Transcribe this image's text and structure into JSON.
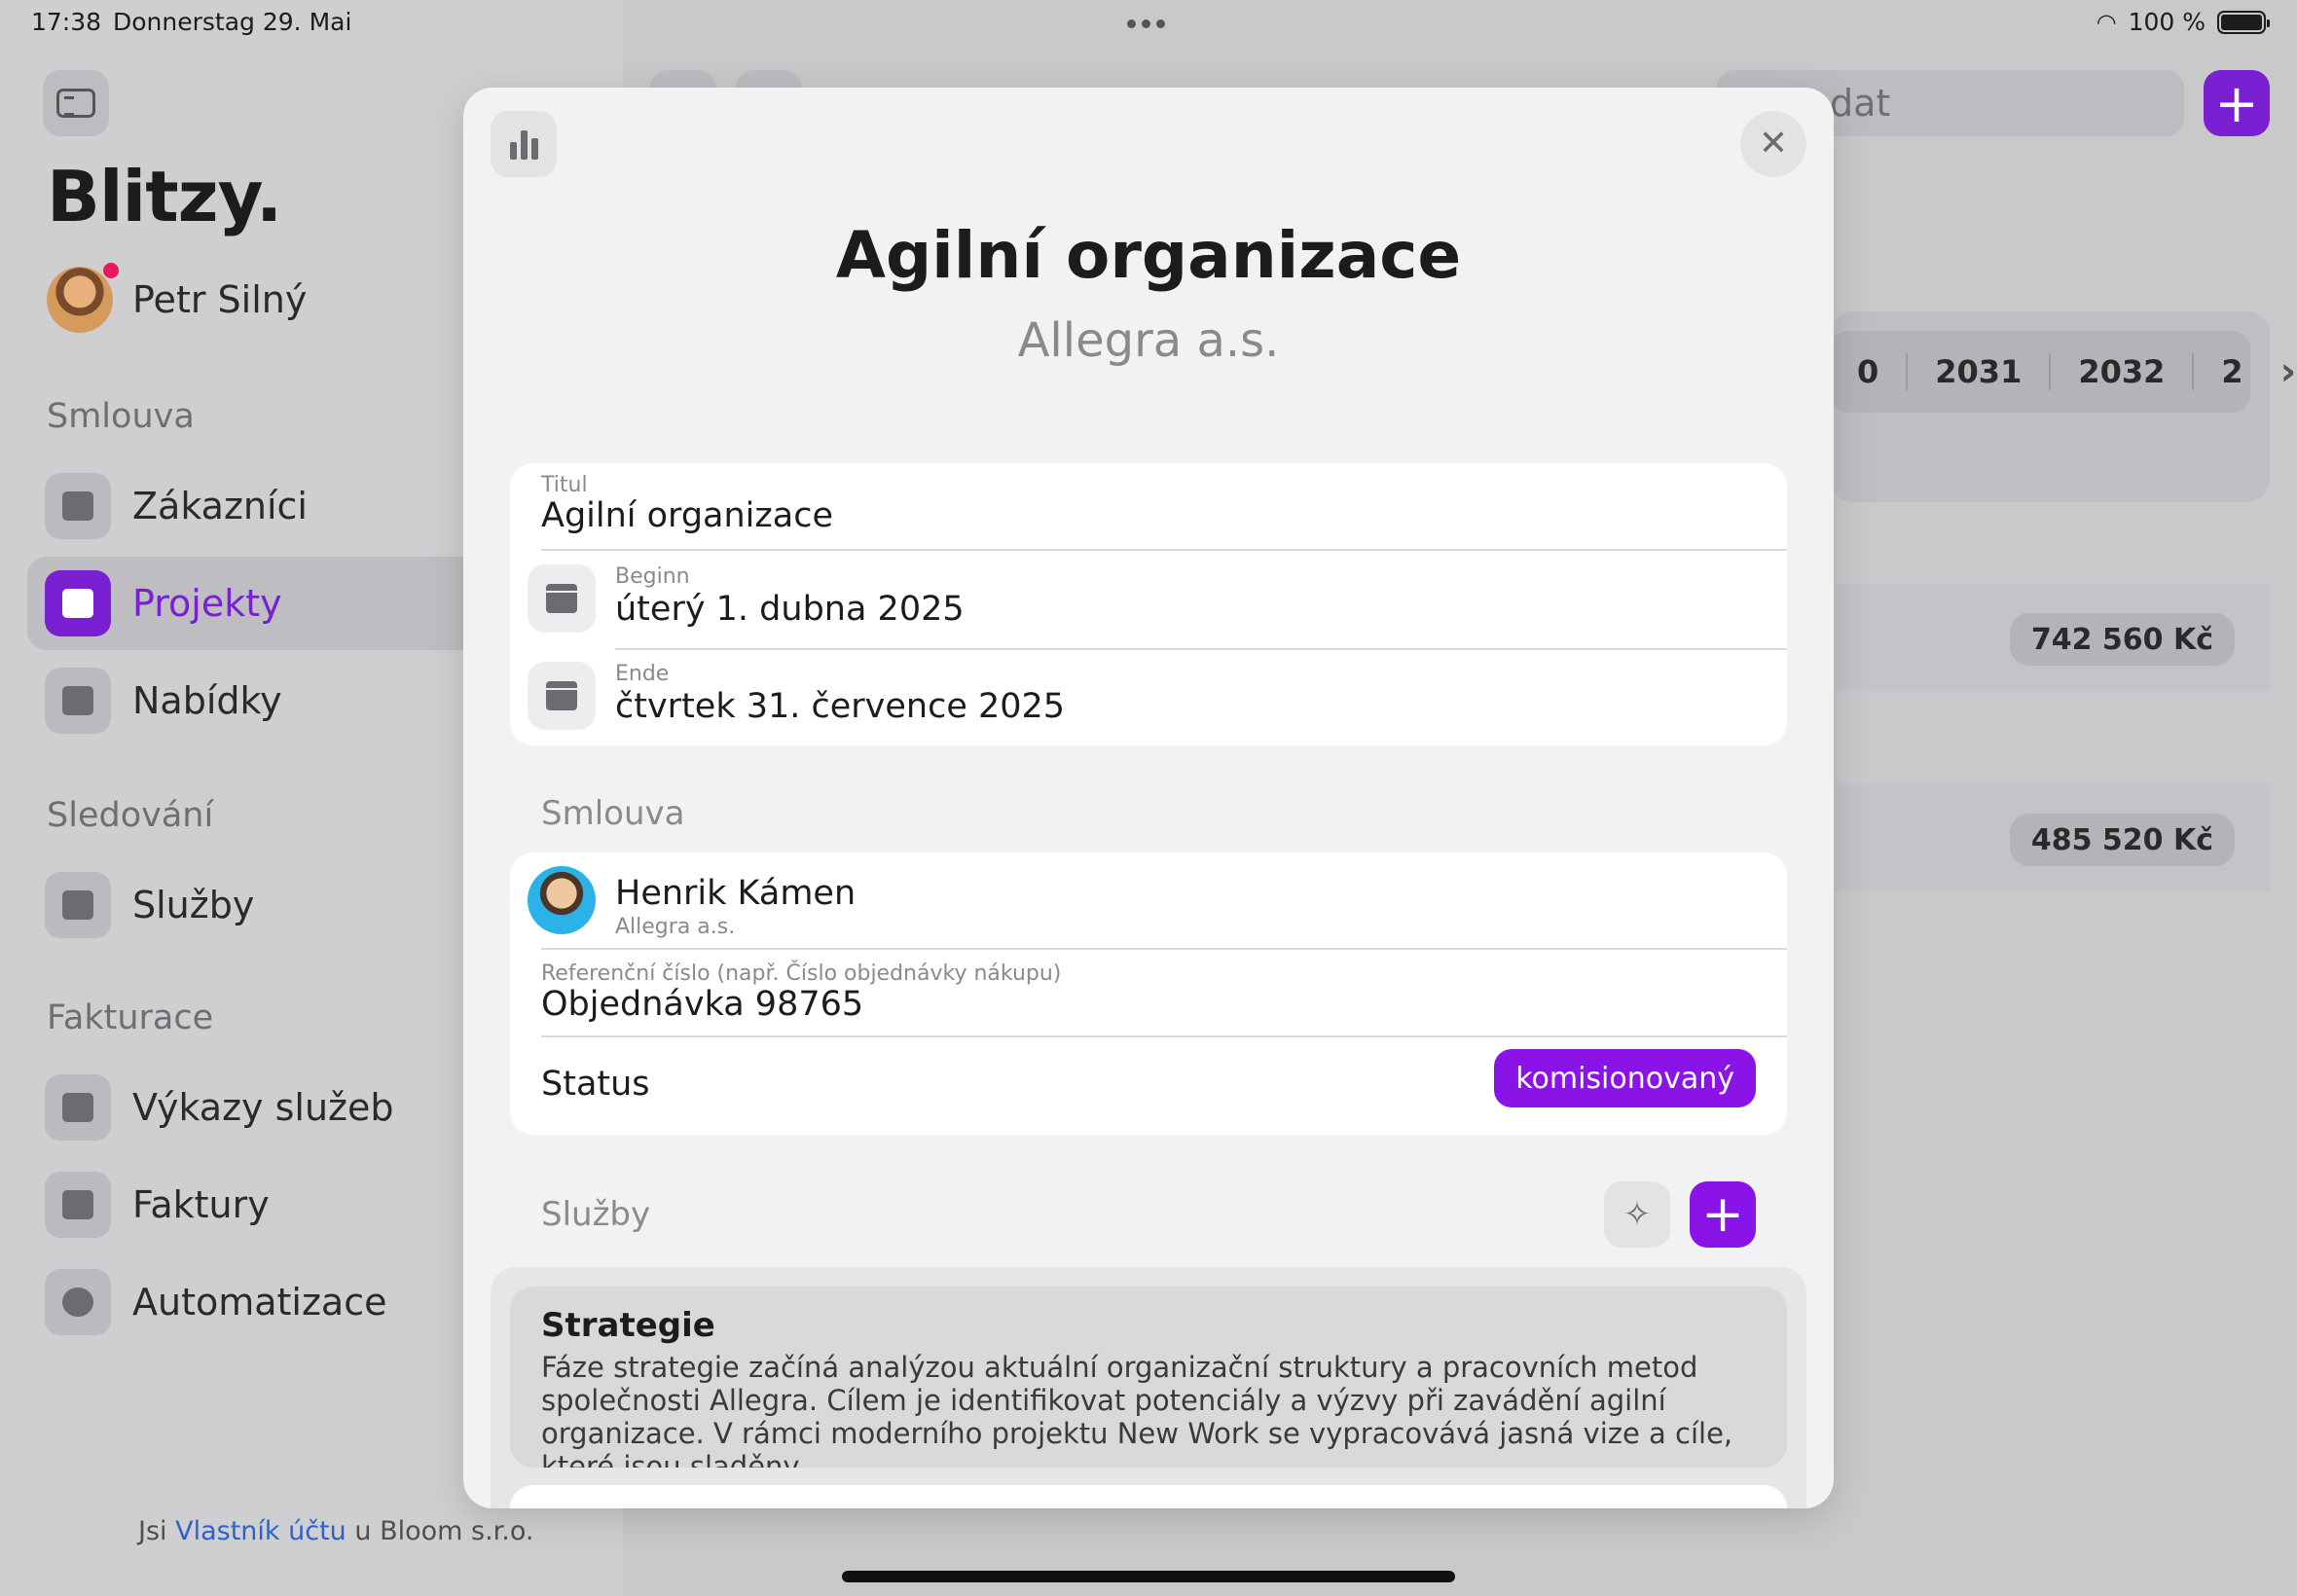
{
  "statusbar": {
    "time": "17:38",
    "date": "Donnerstag 29. Mai",
    "battery": "100 %"
  },
  "sidebar": {
    "brand": "Blitzy.",
    "user": {
      "name": "Petr Silný",
      "notification": true
    },
    "sections": [
      {
        "label": "Smlouva",
        "items": [
          {
            "label": "Zákazníci",
            "icon": "contact-card-icon",
            "active": false
          },
          {
            "label": "Projekty",
            "icon": "book-icon",
            "active": true
          },
          {
            "label": "Nabídky",
            "icon": "document-icon",
            "active": false
          }
        ]
      },
      {
        "label": "Sledování",
        "items": [
          {
            "label": "Služby",
            "icon": "calendar-icon",
            "active": false
          }
        ]
      },
      {
        "label": "Fakturace",
        "items": [
          {
            "label": "Výkazy služeb",
            "icon": "signature-icon",
            "active": false
          },
          {
            "label": "Faktury",
            "icon": "receipt-icon",
            "active": false
          },
          {
            "label": "Automatizace",
            "icon": "timer-icon",
            "active": false
          }
        ]
      }
    ],
    "footer": {
      "prefix": "Jsi ",
      "link": "Vlastník účtu",
      "suffix": " u Bloom s.r.o."
    }
  },
  "background": {
    "search_placeholder": "dat",
    "years": [
      "0",
      "2031",
      "2032",
      "2"
    ],
    "amounts": [
      "742 560 Kč",
      "485 520 Kč"
    ]
  },
  "modal": {
    "title": "Agilní organizace",
    "subtitle": "Allegra a.s.",
    "fields": {
      "titul": {
        "label": "Titul",
        "value": "Agilní organizace"
      },
      "beginn": {
        "label": "Beginn",
        "value": "úterý 1. dubna 2025"
      },
      "ende": {
        "label": "Ende",
        "value": "čtvrtek 31. července 2025"
      }
    },
    "contract": {
      "section_label": "Smlouva",
      "contact_name": "Henrik Kámen",
      "contact_company": "Allegra a.s.",
      "reference_label": "Referenční číslo (např. Číslo objednávky nákupu)",
      "reference_value": "Objednávka 98765",
      "status_label": "Status",
      "status_value": "komisionovaný"
    },
    "services": {
      "section_label": "Služby",
      "items": [
        {
          "title": "Strategie",
          "description": "Fáze strategie začíná analýzou aktuální organizační struktury a pracovních metod společnosti Allegra. Cílem je identifikovat potenciály a výzvy při zavádění agilní organizace. V rámci moderního projektu New Work se vypracovává jasná vize a cíle, které jsou sladěny…"
        }
      ]
    }
  },
  "colors": {
    "accent": "#8a14e8",
    "sidebar_active": "#7a1fd1",
    "notification": "#e8195e",
    "link": "#2f62c8"
  }
}
